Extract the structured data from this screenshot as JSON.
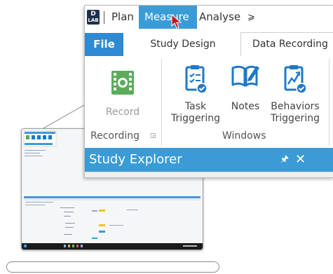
{
  "menu": {
    "items": [
      "Plan",
      "Measure",
      "Analyse"
    ],
    "active": "Measure",
    "overflow_glyph": "⩾"
  },
  "tabs": {
    "file": "File",
    "items": [
      "Study Design",
      "Data Recording"
    ],
    "selected": "Data Recording"
  },
  "ribbon": {
    "groups": [
      {
        "label": "Recording",
        "buttons": [
          {
            "label": "Record",
            "icon": "film-record-icon",
            "enabled": false
          }
        ]
      },
      {
        "label": "Windows",
        "buttons": [
          {
            "label_lines": [
              "Task",
              "Triggering"
            ],
            "icon": "task-triggering-icon",
            "enabled": true
          },
          {
            "label_lines": [
              "Notes"
            ],
            "icon": "notes-book-icon",
            "enabled": true
          },
          {
            "label_lines": [
              "Behaviors",
              "Triggering"
            ],
            "icon": "behaviors-triggering-icon",
            "enabled": true
          }
        ]
      }
    ]
  },
  "panel": {
    "title": "Study Explorer"
  },
  "colors": {
    "accent": "#3b9bd7",
    "file_tab": "#2e8ad2",
    "icon_blue": "#1f78c8",
    "record_green": "#5bab5b",
    "taskbar": "#1b1b1b"
  }
}
